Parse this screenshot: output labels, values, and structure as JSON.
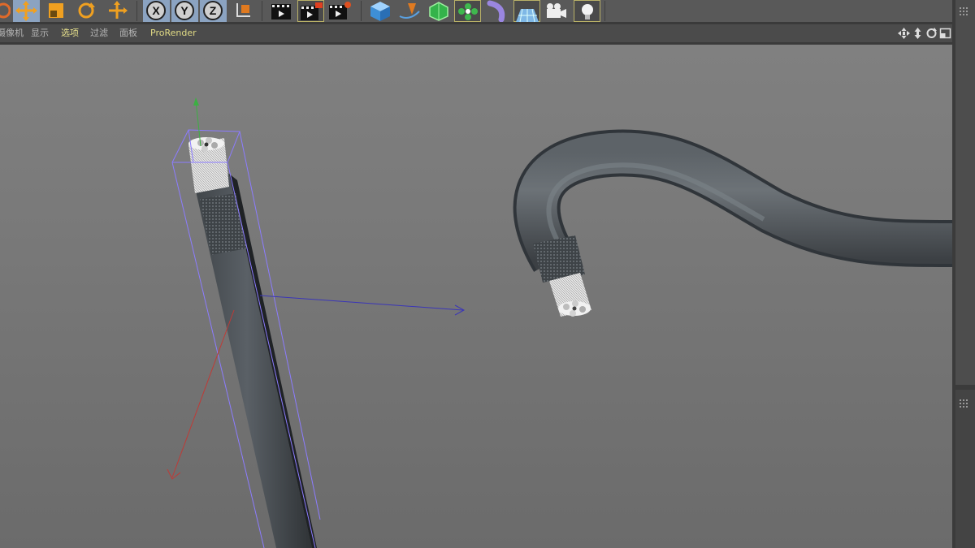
{
  "toolbar": {
    "tools": [
      {
        "name": "live-selection-icon",
        "state": "normal"
      },
      {
        "name": "move-icon",
        "state": "active"
      },
      {
        "name": "scale-icon",
        "state": "normal"
      },
      {
        "name": "rotate-icon",
        "state": "normal"
      },
      {
        "name": "recent-tool-icon",
        "state": "normal"
      },
      {
        "name": "x-axis-lock-icon",
        "label": "X"
      },
      {
        "name": "y-axis-lock-icon",
        "label": "Y"
      },
      {
        "name": "z-axis-lock-icon",
        "label": "Z"
      },
      {
        "name": "coordinate-system-icon"
      },
      {
        "name": "render-view-icon"
      },
      {
        "name": "render-to-picture-viewer-icon"
      },
      {
        "name": "edit-render-settings-icon"
      },
      {
        "name": "cube-icon"
      },
      {
        "name": "pen-spline-icon"
      },
      {
        "name": "subdivision-surface-icon"
      },
      {
        "name": "array-icon"
      },
      {
        "name": "bend-deformer-icon"
      },
      {
        "name": "floor-icon"
      },
      {
        "name": "camera-icon"
      },
      {
        "name": "light-icon"
      }
    ]
  },
  "menubar": {
    "items": [
      {
        "label": "摄像机",
        "key": "cameras"
      },
      {
        "label": "显示",
        "key": "display"
      },
      {
        "label": "选项",
        "key": "options",
        "active": true
      },
      {
        "label": "过滤",
        "key": "filter"
      },
      {
        "label": "面板",
        "key": "panel"
      },
      {
        "label": "ProRender",
        "key": "prorender"
      }
    ],
    "view_controls": [
      "pan-view-icon",
      "zoom-view-icon",
      "rotate-view-icon",
      "toggle-view-icon"
    ]
  },
  "viewport": {
    "background": "#7a7a7a",
    "cable_color": "#4b5055",
    "selection_box_color": "#8c7cff",
    "axis_colors": {
      "x": "#c03a36",
      "y": "#3cb043",
      "z": "#3a35b8"
    }
  },
  "colors": {
    "toolbar_bg": "#595959",
    "menubar_bg": "#4b4b4b",
    "accent_active": "#8ba3c1",
    "menu_active_text": "#e7e08c"
  }
}
